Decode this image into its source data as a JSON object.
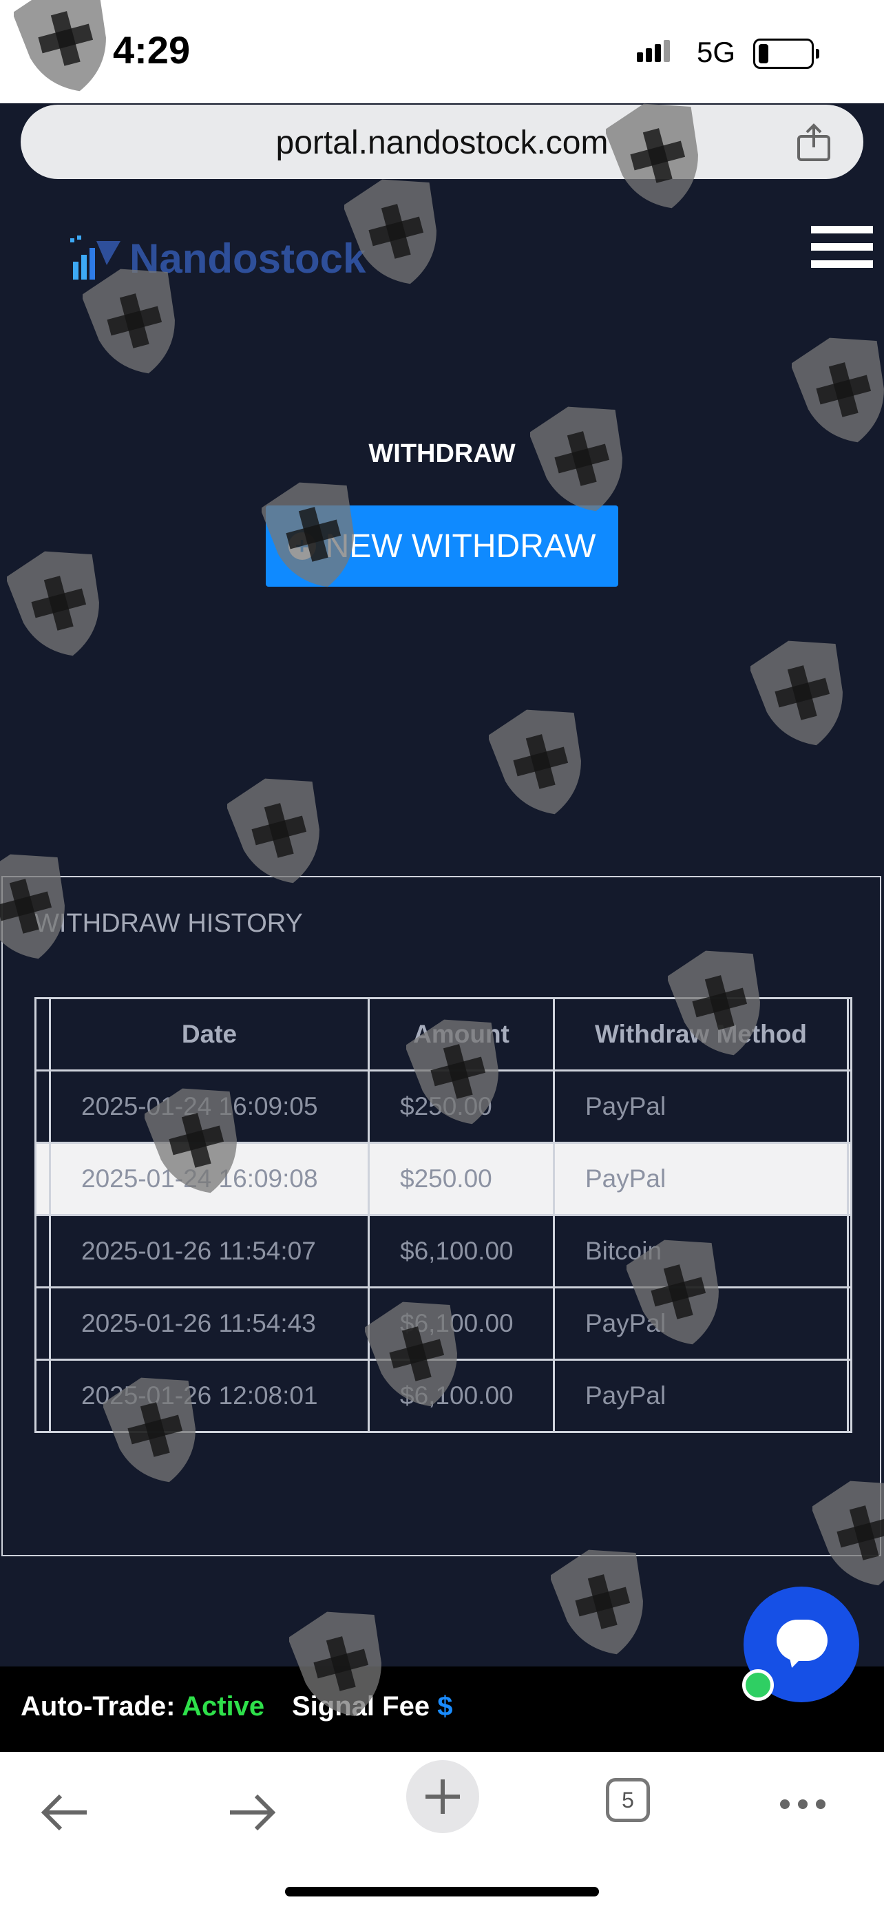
{
  "status_bar": {
    "time": "4:29",
    "network": "5G"
  },
  "browser": {
    "url": "portal.nandostock.com",
    "tab_count": "5"
  },
  "brand": {
    "name": "Nandostock"
  },
  "page": {
    "title": "WITHDRAW",
    "new_button_label": "NEW WITHDRAW"
  },
  "history": {
    "title": "WITHDRAW HISTORY",
    "columns": [
      "Date",
      "Amount",
      "Withdraw Method"
    ],
    "rows": [
      {
        "date": "2025-01-24 16:09:05",
        "amount": "$250.00",
        "method": "PayPal"
      },
      {
        "date": "2025-01-24 16:09:08",
        "amount": "$250.00",
        "method": "PayPal"
      },
      {
        "date": "2025-01-26 11:54:07",
        "amount": "$6,100.00",
        "method": "Bitcoin"
      },
      {
        "date": "2025-01-26 11:54:43",
        "amount": "$6,100.00",
        "method": "PayPal"
      },
      {
        "date": "2025-01-26 12:08:01",
        "amount": "$6,100.00",
        "method": "PayPal"
      }
    ]
  },
  "ticker": {
    "auto_trade_label": "Auto-Trade:",
    "auto_trade_status": "Active",
    "signal_fee_label": "Signal Fee",
    "signal_fee_value": "$"
  },
  "colors": {
    "accent": "#0f8aff",
    "background": "#141a2c",
    "active": "#2ee04a"
  }
}
